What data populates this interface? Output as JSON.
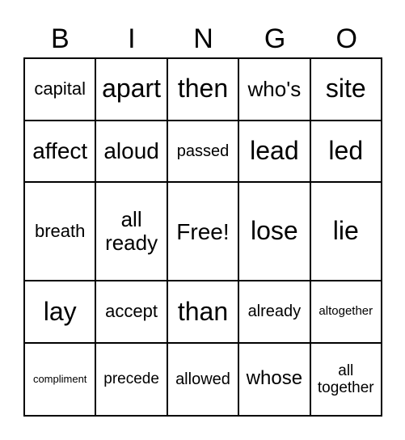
{
  "header": [
    "B",
    "I",
    "N",
    "G",
    "O"
  ],
  "rows": [
    [
      "capital",
      "apart",
      "then",
      "who's",
      "site"
    ],
    [
      "affect",
      "aloud",
      "passed",
      "lead",
      "led"
    ],
    [
      "breath",
      "all ready",
      "Free!",
      "lose",
      "lie"
    ],
    [
      "lay",
      "accept",
      "than",
      "already",
      "altogether"
    ],
    [
      "compliment",
      "precede",
      "allowed",
      "whose",
      "all together"
    ]
  ]
}
